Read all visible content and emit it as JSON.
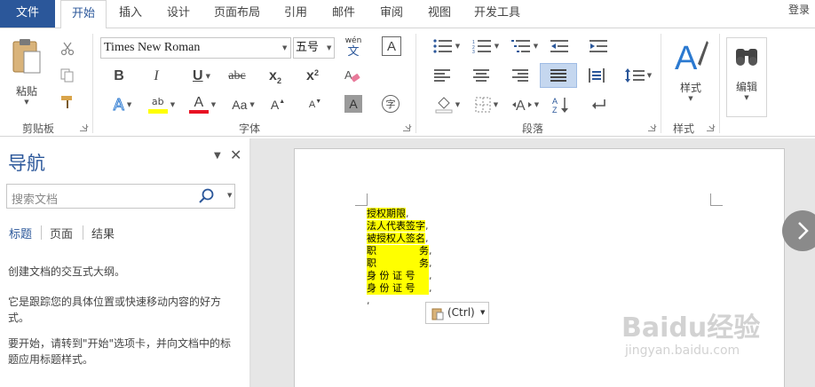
{
  "tabs": {
    "file": "文件",
    "items": [
      "开始",
      "插入",
      "设计",
      "页面布局",
      "引用",
      "邮件",
      "审阅",
      "视图",
      "开发工具"
    ],
    "active_index": 0,
    "login": "登录"
  },
  "ribbon": {
    "clipboard": {
      "paste_label": "粘贴",
      "group_label": "剪贴板"
    },
    "font": {
      "font_name": "Times New Roman",
      "font_size": "五号",
      "wen_top": "wén",
      "wen_bottom": "文",
      "bold": "B",
      "italic": "I",
      "underline": "U",
      "strikethrough": "abc",
      "subscript": "x",
      "sub_mark": "2",
      "superscript": "x",
      "sup_mark": "2",
      "change_case": "Aa",
      "grow": "A",
      "shrink": "A",
      "char_shade": "A",
      "enclose": "字",
      "highlight": "ab",
      "group_label": "字体"
    },
    "paragraph": {
      "group_label": "段落"
    },
    "styles": {
      "label": "样式",
      "group_label": "样式"
    },
    "editing": {
      "label": "编辑"
    },
    "colors": {
      "accent": "#2b579a",
      "highlight_yellow": "#ffff00",
      "font_red": "#e81123",
      "selected_bg": "#c5d7ef"
    }
  },
  "nav": {
    "title": "导航",
    "search_placeholder": "搜索文档",
    "tabs": [
      "标题",
      "页面",
      "结果"
    ],
    "active_tab": 0,
    "text1": "创建文档的交互式大纲。",
    "text2": "它是跟踪您的具体位置或快速移动内容的好方式。",
    "text3": "要开始，请转到\"开始\"选项卡，并向文档中的标题应用标题样式。"
  },
  "document": {
    "lines": [
      "授权期限",
      "法人代表签字",
      "被授权人签名",
      "职",
      "职",
      "身 份 证 号",
      "身 份 证 号"
    ],
    "line_tails": [
      "",
      "",
      "",
      "务",
      "务",
      "",
      ""
    ],
    "paste_options": "(Ctrl)"
  },
  "watermark": {
    "text": "Baidu经验",
    "url": "jingyan.baidu.com"
  }
}
